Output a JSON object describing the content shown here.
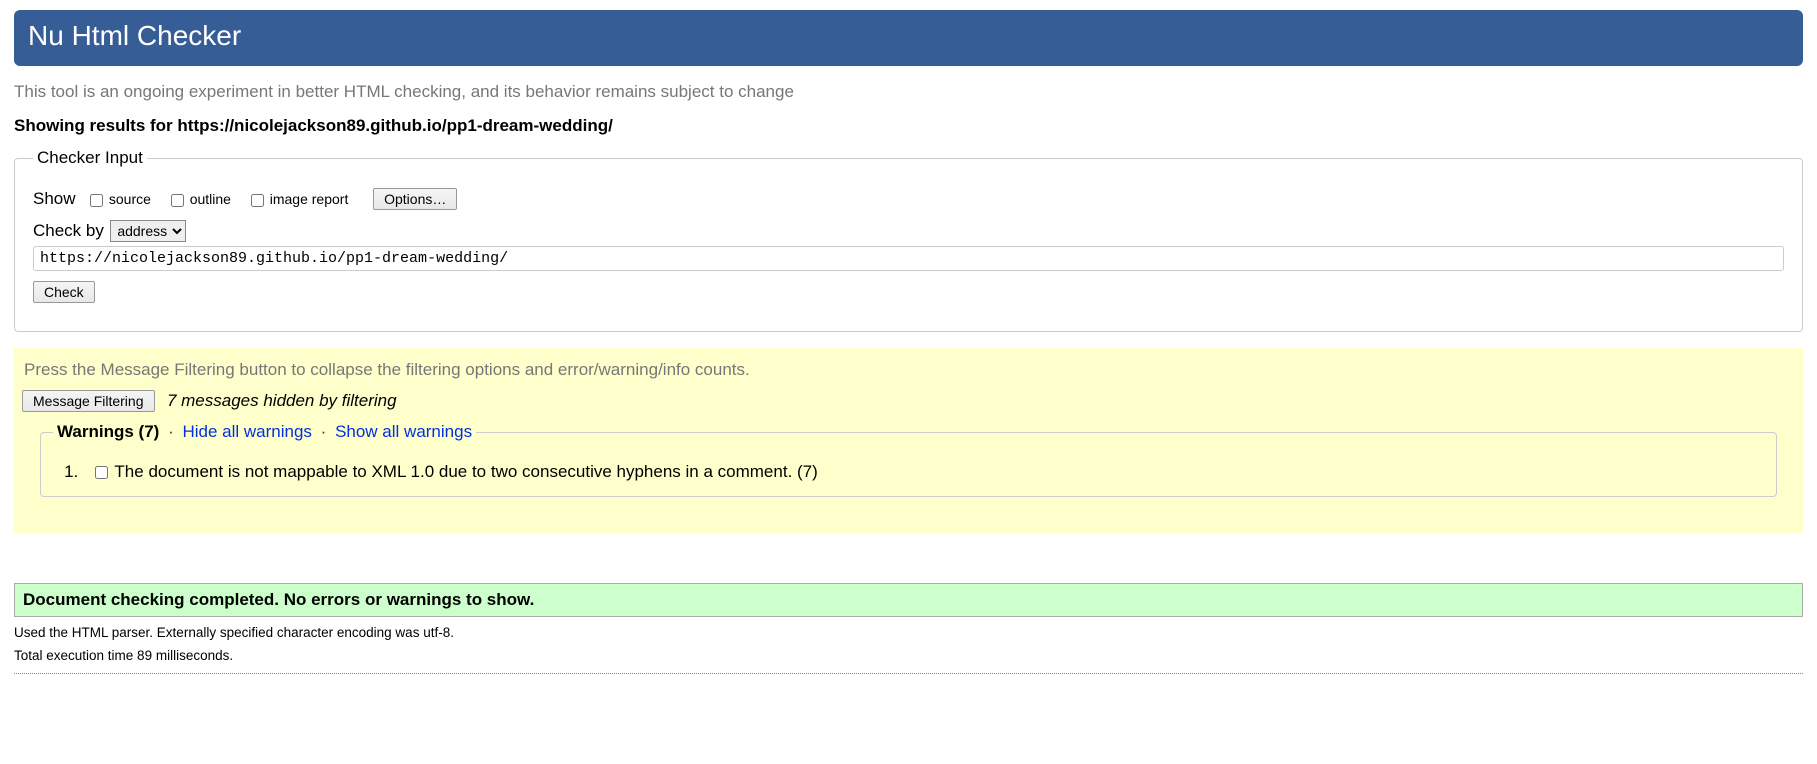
{
  "header": {
    "title": "Nu Html Checker"
  },
  "description": "This tool is an ongoing experiment in better HTML checking, and its behavior remains subject to change",
  "results_for": "Showing results for https://nicolejackson89.github.io/pp1-dream-wedding/",
  "checker_input": {
    "legend": "Checker Input",
    "show_label": "Show",
    "source_label": "source",
    "outline_label": "outline",
    "image_report_label": "image report",
    "options_button": "Options…",
    "check_by_label": "Check by",
    "check_by_select": "address",
    "url_value": "https://nicolejackson89.github.io/pp1-dream-wedding/",
    "check_button": "Check"
  },
  "filtering": {
    "hint": "Press the Message Filtering button to collapse the filtering options and error/warning/info counts.",
    "button": "Message Filtering",
    "hidden_text": "7 messages hidden by filtering",
    "warnings_legend_title": "Warnings (7)",
    "hide_all": "Hide all warnings",
    "show_all": "Show all warnings",
    "warning_item": "The document is not mappable to XML 1.0 due to two consecutive hyphens in a comment. (7)"
  },
  "success": "Document checking completed. No errors or warnings to show.",
  "footer": {
    "parser_line": "Used the HTML parser. Externally specified character encoding was utf-8.",
    "time_line": "Total execution time 89 milliseconds."
  }
}
